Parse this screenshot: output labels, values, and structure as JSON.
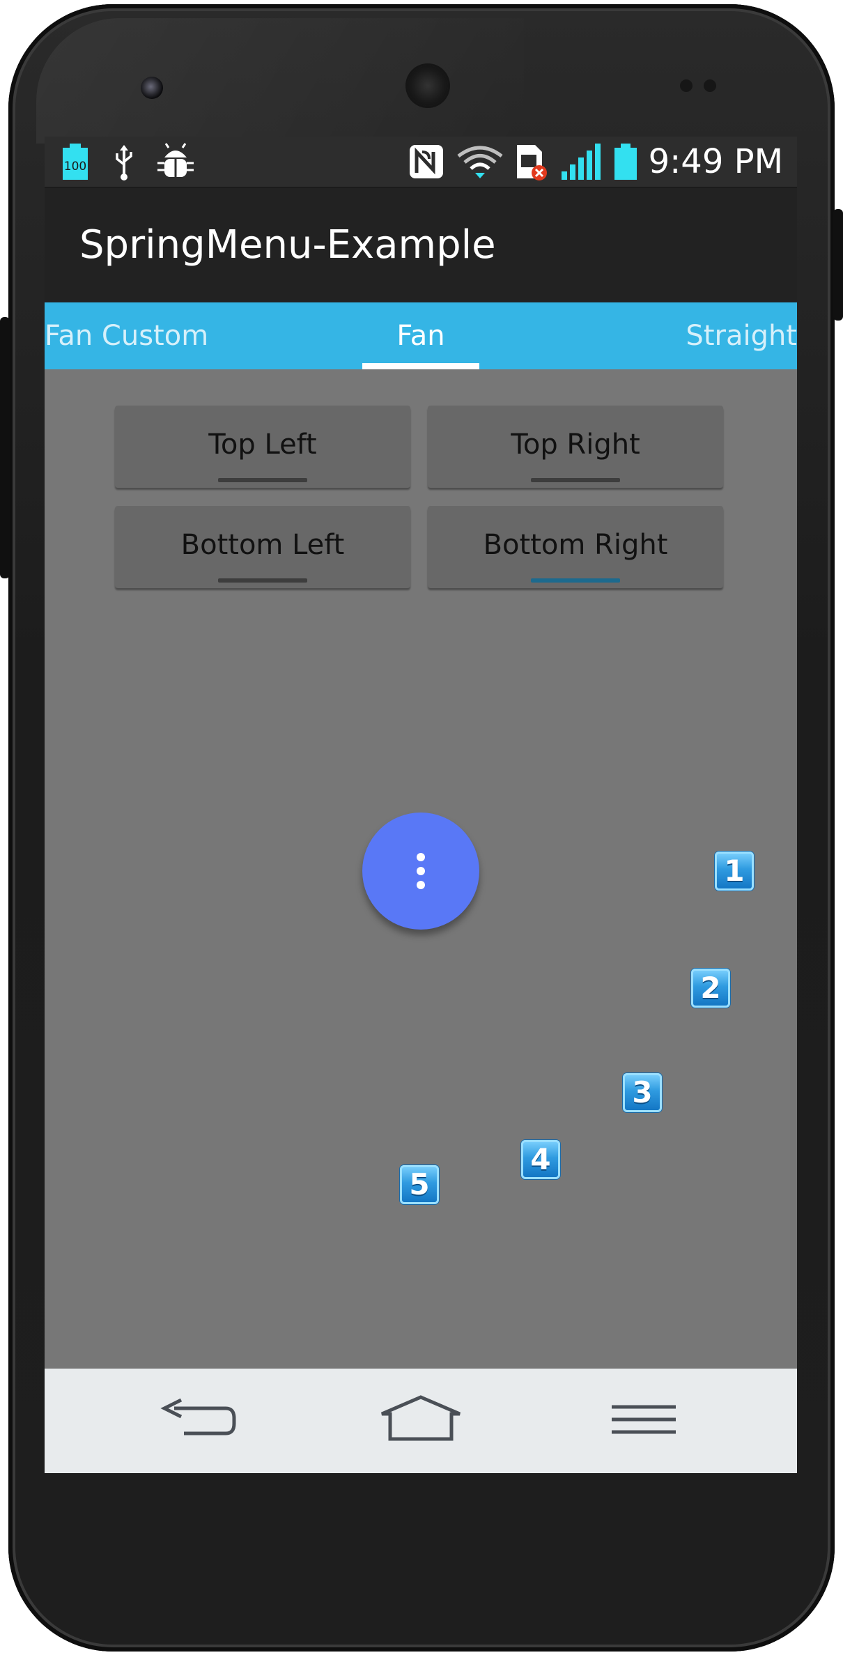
{
  "status_bar": {
    "battery_level_text": "100",
    "time": "9:49 PM",
    "icons": [
      "battery-100-icon",
      "usb-icon",
      "android-debug-icon",
      "nfc-icon",
      "wifi-icon",
      "sim-error-icon",
      "signal-icon",
      "battery-icon"
    ]
  },
  "app_bar": {
    "title": "SpringMenu-Example"
  },
  "tabs": {
    "items": [
      "Fan Custom",
      "Fan",
      "Straight"
    ],
    "selected": "Fan"
  },
  "buttons": {
    "top_left": "Top Left",
    "top_right": "Top Right",
    "bottom_left": "Bottom Left",
    "bottom_right": "Bottom Right",
    "selected": "Bottom Right"
  },
  "fab": {
    "icon": "more-vertical-icon",
    "color": "#5978f6"
  },
  "menu_items": [
    "1",
    "2",
    "3",
    "4",
    "5"
  ],
  "nav_bar": {
    "icons": [
      "back-icon",
      "home-icon",
      "menu-icon"
    ]
  },
  "colors": {
    "tab_bar": "#35b5e5",
    "content_background": "#777777",
    "action_bar": "#222222",
    "nav_bar": "#e8ebed"
  }
}
